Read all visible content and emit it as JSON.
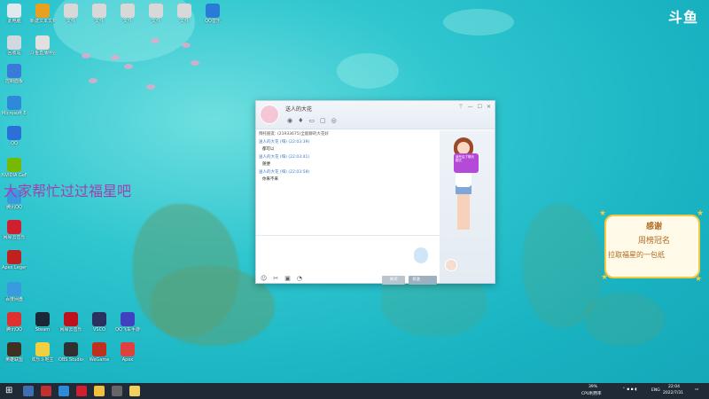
{
  "stream": {
    "logo": "斗鱼",
    "overlay_text": "大家帮忙过过福星吧"
  },
  "sticker": {
    "line1": "感谢",
    "line2": "周榜冠名",
    "line3": "拉取福星的一包纸"
  },
  "chat_window": {
    "title": "送人的大花",
    "system_line": "拜托朋友: (21933675)全能聊的大花好",
    "messages": [
      {
        "who": "送人的大花 (嗨) (22:03:39)",
        "text": "都可以"
      },
      {
        "who": "送人的大花 (嗨) (22:03:41)",
        "text": "随便"
      },
      {
        "who": "送人的大花 (嗨) (22:03:58)",
        "text": "你来不来"
      }
    ],
    "bubble": "我开启了聊天模式",
    "close_label": "关闭",
    "send_label": "发送"
  },
  "desktop_icons": [
    {
      "label": "此电脑"
    },
    {
      "label": "新建文本文档"
    },
    {
      "label": "文件"
    },
    {
      "label": "文件"
    },
    {
      "label": "文件"
    },
    {
      "label": "文件"
    },
    {
      "label": "文件"
    },
    {
      "label": "QQ音乐"
    },
    {
      "label": "回收站"
    },
    {
      "label": "斗鱼直播伴侣"
    },
    {
      "label": "控制面板"
    },
    {
      "label": "Microsoft Edge"
    },
    {
      "label": "QQ"
    },
    {
      "label": "NVIDIA GeForce"
    },
    {
      "label": "腾讯QQ"
    },
    {
      "label": "网易云音乐"
    },
    {
      "label": "Apex Legends"
    },
    {
      "label": "百度网盘"
    },
    {
      "label": "腾讯QQ"
    },
    {
      "label": "Steam"
    },
    {
      "label": "网易云音乐"
    },
    {
      "label": "VSCO"
    },
    {
      "label": "QQ飞车手游"
    },
    {
      "label": "英雄联盟"
    },
    {
      "label": "欢乐斗地主"
    },
    {
      "label": "OBS Studio"
    },
    {
      "label": "WeGame"
    },
    {
      "label": "Apex"
    }
  ],
  "taskbar": {
    "cpu_pct": "39%",
    "cpu_label": "CPU利用率",
    "lang": "ENG",
    "time": "22:04",
    "date": "2022/7/31"
  },
  "colors": {
    "water": "#2fc6cf",
    "taskbar": "#1f2a36",
    "accent_blue": "#3a7ac8",
    "overlay_purple": "#a040b0"
  }
}
